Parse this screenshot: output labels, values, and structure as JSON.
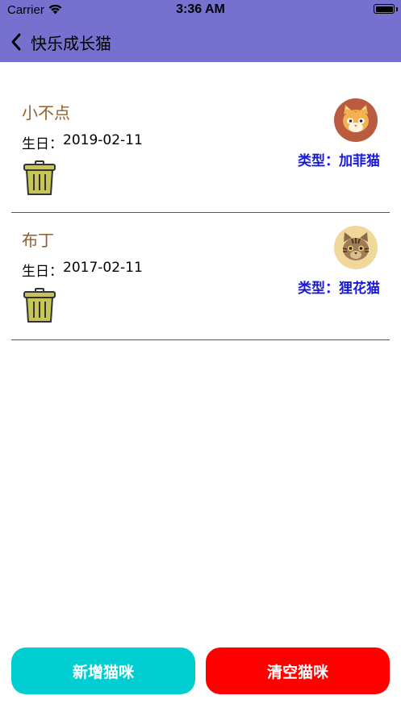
{
  "status_bar": {
    "carrier": "Carrier",
    "time": "3:36 AM"
  },
  "nav": {
    "title": "快乐成长猫"
  },
  "cats": [
    {
      "name": "小不点",
      "birthday_label": "生日：",
      "birthday": "2019-02-11",
      "type_label": "类型：",
      "type": "加菲猫",
      "avatar_icon": "orange-cat-face-icon"
    },
    {
      "name": "布丁",
      "birthday_label": "生日：",
      "birthday": "2017-02-11",
      "type_label": "类型：",
      "type": "狸花猫",
      "avatar_icon": "tabby-cat-face-icon"
    }
  ],
  "buttons": {
    "add": "新增猫咪",
    "clear": "清空猫咪"
  },
  "colors": {
    "header_bg": "#7670cf",
    "name_color": "#8e5f2f",
    "type_color": "#1a1ad6",
    "add_button": "#00ced1",
    "clear_button": "#ff0000"
  }
}
